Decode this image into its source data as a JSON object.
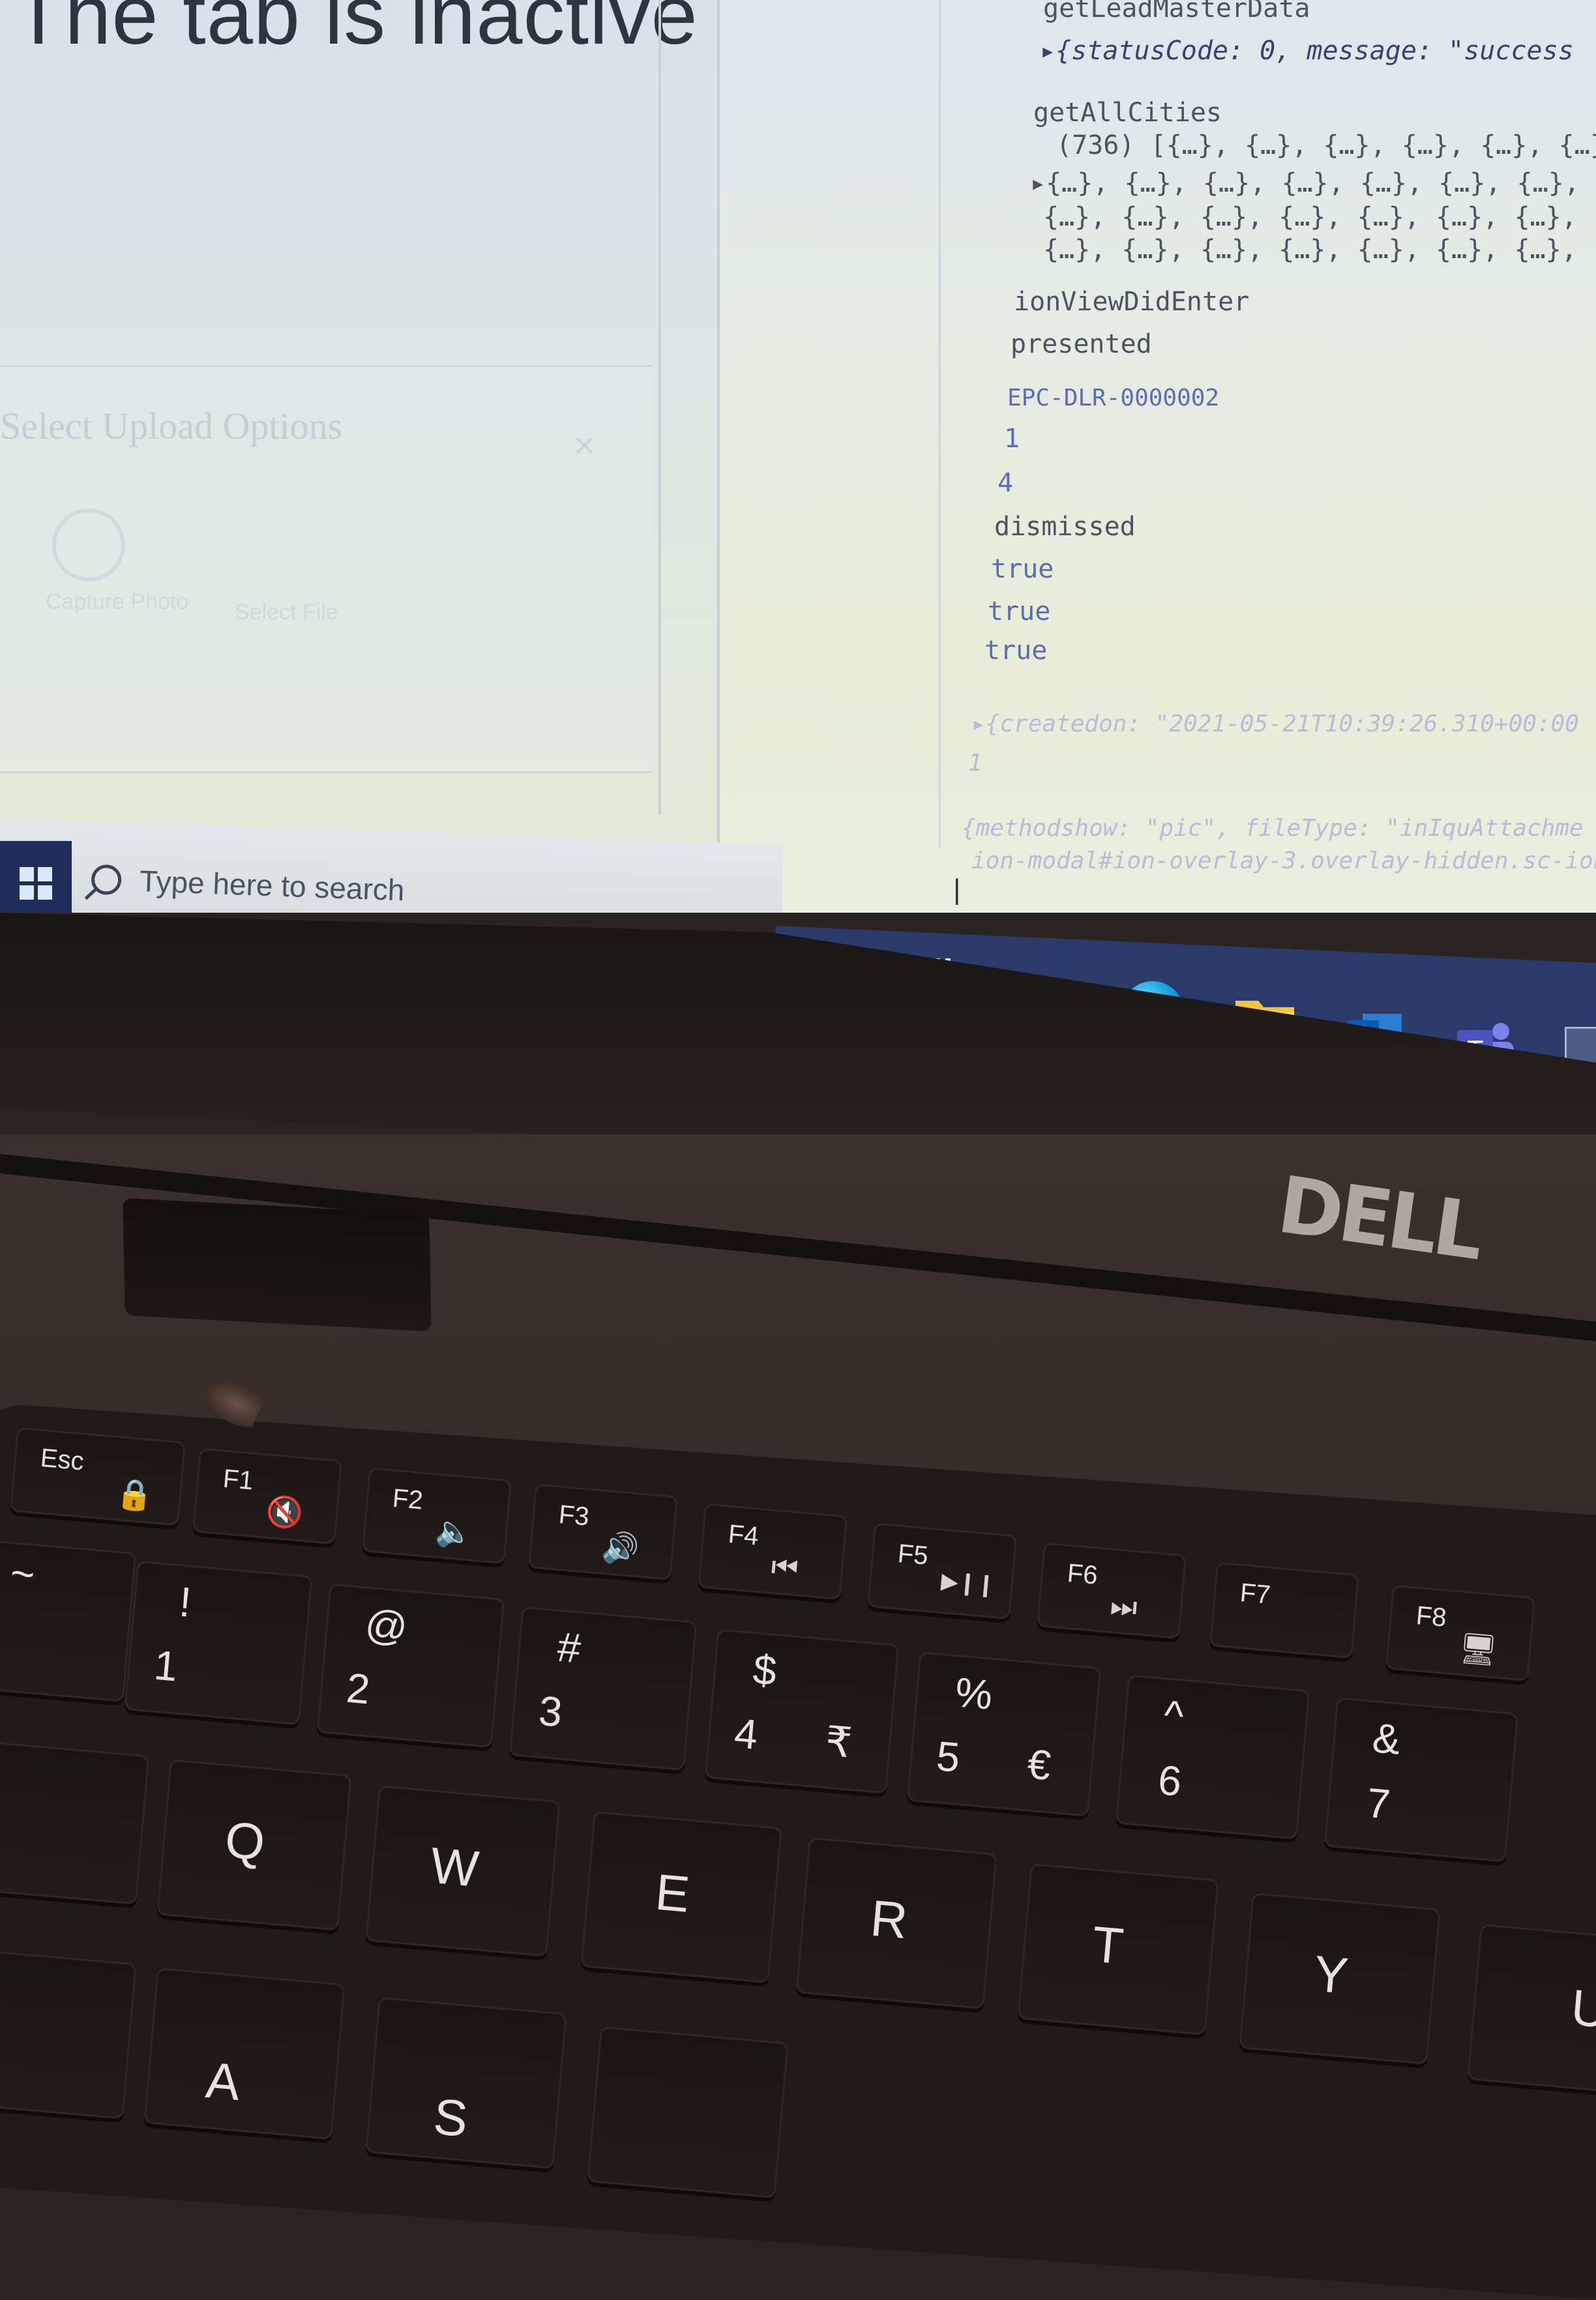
{
  "left_pane": {
    "title": "The tab is inactive",
    "modal_title": "Select Upload Options",
    "modal_close": "×",
    "option_1": "Capture Photo",
    "option_2": "Select File"
  },
  "console": {
    "lines": [
      "getLeadMasterData",
      "▸{statusCode: 0, message: \"success",
      "getAllCities",
      "(736) [{…}, {…}, {…}, {…}, {…}, {…}, {",
      "▸{…}, {…}, {…}, {…}, {…}, {…}, {…},",
      "{…}, {…}, {…}, {…}, {…}, {…}, {…},",
      "{…}, {…}, {…}, {…}, {…}, {…}, {…},",
      "ionViewDidEnter",
      "presented",
      "EPC-DLR-0000002",
      "1",
      "4",
      "dismissed",
      "true",
      "true",
      "true",
      "▸{createdon: \"2021-05-21T10:39:26.310+00:00",
      "1",
      "{methodshow: \"pic\", fileType: \"inIquAttachme",
      "ion-modal#ion-overlay-3.overlay-hidden.sc-ion"
    ],
    "caret": "|"
  },
  "taskbar": {
    "search_placeholder": "Type here to search",
    "icons": [
      "cortana-icon",
      "task-view-icon",
      "snip-sketch-icon",
      "edge-icon",
      "file-explorer-icon",
      "outlook-icon",
      "teams-icon",
      "app-icon"
    ]
  },
  "laptop": {
    "brand": "DELL"
  },
  "keyboard": {
    "function_row": [
      {
        "label": "Esc",
        "sym": "🔒"
      },
      {
        "label": "F1",
        "sym": "🔇"
      },
      {
        "label": "F2",
        "sym": "🔈"
      },
      {
        "label": "F3",
        "sym": "🔊"
      },
      {
        "label": "F4",
        "sym": "⏮"
      },
      {
        "label": "F5",
        "sym": "▶❙❙"
      },
      {
        "label": "F6",
        "sym": "⏭"
      },
      {
        "label": "F7",
        "sym": ""
      },
      {
        "label": "F8",
        "sym": "🖥"
      }
    ],
    "number_row": [
      {
        "top": "~",
        "bottom": "",
        "alt": ""
      },
      {
        "top": "!",
        "bottom": "1",
        "alt": ""
      },
      {
        "top": "@",
        "bottom": "2",
        "alt": ""
      },
      {
        "top": "#",
        "bottom": "3",
        "alt": ""
      },
      {
        "top": "$",
        "bottom": "4",
        "alt": "₹"
      },
      {
        "top": "%",
        "bottom": "5",
        "alt": "€"
      },
      {
        "top": "^",
        "bottom": "6",
        "alt": ""
      },
      {
        "top": "&",
        "bottom": "7",
        "alt": ""
      }
    ],
    "qwerty_row": [
      "Q",
      "W",
      "E",
      "R",
      "T",
      "Y",
      "U"
    ],
    "home_row": [
      "A",
      "S"
    ]
  },
  "colors": {
    "taskbar_accent": "#2a3a6a",
    "console_text": "#4b5560",
    "object_text": "#3a4370"
  }
}
